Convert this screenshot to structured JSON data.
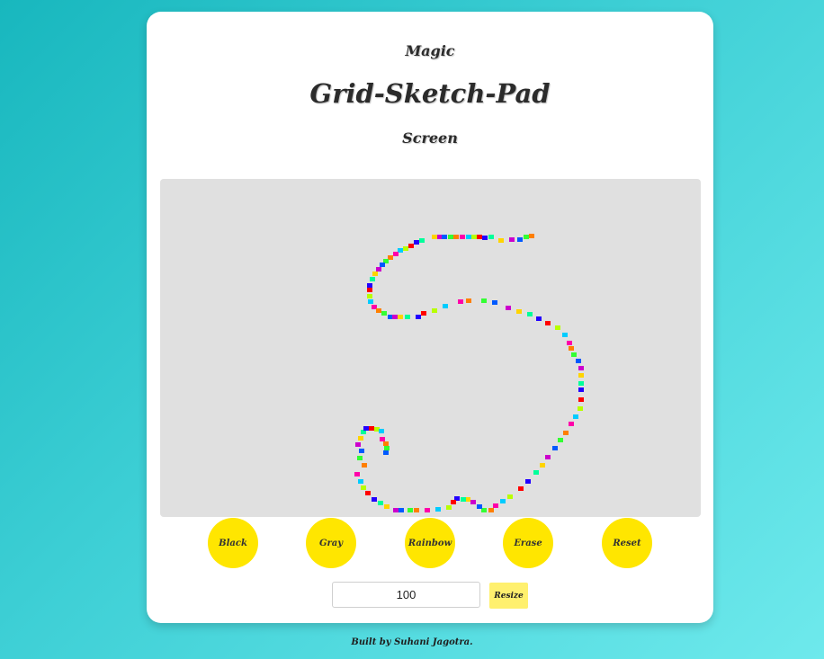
{
  "header": {
    "line1": "Magic",
    "title": "Grid-Sketch-Pad",
    "line3": "Screen"
  },
  "controls": {
    "black_label": "Black",
    "gray_label": "Gray",
    "rainbow_label": "Rainbow",
    "erase_label": "Erase",
    "reset_label": "Reset",
    "resize_label": "Resize",
    "grid_size_value": "100"
  },
  "footer": {
    "credit": "Built by Suhani Jagotra."
  },
  "colors": {
    "background_gradient": [
      "#18b7be",
      "#6ee9ec"
    ],
    "card": "#ffffff",
    "pad": "#e0e0e0",
    "button_yellow": "#ffe600",
    "resize_yellow": "#fff06e",
    "rainbow_palette": [
      "#ff0000",
      "#ff7f00",
      "#ffd400",
      "#b8ff00",
      "#33ff33",
      "#00ff9a",
      "#00ccff",
      "#0059ff",
      "#2200ff",
      "#ff00aa",
      "#cc00cc"
    ]
  }
}
